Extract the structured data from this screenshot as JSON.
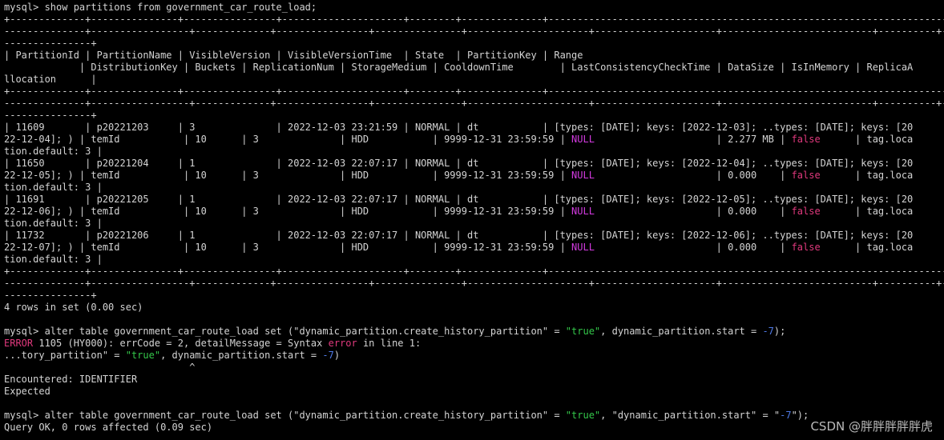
{
  "terminal": {
    "lines": [
      [
        {
          "t": "mysql> show partitions from government_car_route_load;",
          "c": "default"
        }
      ],
      [
        {
          "t": "+-------------+---------------+----------------+---------------------+--------+--------------+--------------------------------------------------------------------------------+----------+--------------",
          "c": "default"
        }
      ],
      [
        {
          "t": "--------------+-----------------+-------------+----------------+---------------+---------------------+---------------------+--------------------------+----------+------------+-------------------------",
          "c": "default"
        }
      ],
      [
        {
          "t": "---------------+",
          "c": "default"
        }
      ],
      [
        {
          "t": "| PartitionId | PartitionName | VisibleVersion | VisibleVersionTime  | State  | PartitionKey | Range",
          "c": "default"
        }
      ],
      [
        {
          "t": "             | DistributionKey | Buckets | ReplicationNum | StorageMedium | CooldownTime        | LastConsistencyCheckTime | DataSize | IsInMemory | ReplicaA",
          "c": "default"
        }
      ],
      [
        {
          "t": "llocation      |",
          "c": "default"
        }
      ],
      [
        {
          "t": "+-------------+---------------+----------------+---------------------+--------+--------------+--------------------------------------------------------------------------------+----------+--------------",
          "c": "default"
        }
      ],
      [
        {
          "t": "--------------+-----------------+-------------+----------------+---------------+---------------------+---------------------+--------------------------+----------+------------+-------------------------",
          "c": "default"
        }
      ],
      [
        {
          "t": "---------------+",
          "c": "default"
        }
      ],
      [
        {
          "t": "| 11609       | p20221203     | 3              | 2022-12-03 23:21:59 | NORMAL | dt           | [types: [DATE]; keys: [2022-12-03]; ..types: [DATE]; keys: [20",
          "c": "default"
        }
      ],
      [
        {
          "t": "22-12-04]; ) | temId           | 10      | 3              | HDD           | 9999-12-31 23:59:59 | ",
          "c": "default"
        },
        {
          "t": "NULL",
          "c": "null"
        },
        {
          "t": "                     | 2.277 MB | ",
          "c": "default"
        },
        {
          "t": "false",
          "c": "false"
        },
        {
          "t": "      | tag.loca",
          "c": "default"
        }
      ],
      [
        {
          "t": "tion.default: 3 |",
          "c": "default"
        }
      ],
      [
        {
          "t": "| 11650       | p20221204     | 1              | 2022-12-03 22:07:17 | NORMAL | dt           | [types: [DATE]; keys: [2022-12-04]; ..types: [DATE]; keys: [20",
          "c": "default"
        }
      ],
      [
        {
          "t": "22-12-05]; ) | temId           | 10      | 3              | HDD           | 9999-12-31 23:59:59 | ",
          "c": "default"
        },
        {
          "t": "NULL",
          "c": "null"
        },
        {
          "t": "                     | 0.000    | ",
          "c": "default"
        },
        {
          "t": "false",
          "c": "false"
        },
        {
          "t": "      | tag.loca",
          "c": "default"
        }
      ],
      [
        {
          "t": "tion.default: 3 |",
          "c": "default"
        }
      ],
      [
        {
          "t": "| 11691       | p20221205     | 1              | 2022-12-03 22:07:17 | NORMAL | dt           | [types: [DATE]; keys: [2022-12-05]; ..types: [DATE]; keys: [20",
          "c": "default"
        }
      ],
      [
        {
          "t": "22-12-06]; ) | temId           | 10      | 3              | HDD           | 9999-12-31 23:59:59 | ",
          "c": "default"
        },
        {
          "t": "NULL",
          "c": "null"
        },
        {
          "t": "                     | 0.000    | ",
          "c": "default"
        },
        {
          "t": "false",
          "c": "false"
        },
        {
          "t": "      | tag.loca",
          "c": "default"
        }
      ],
      [
        {
          "t": "tion.default: 3 |",
          "c": "default"
        }
      ],
      [
        {
          "t": "| 11732       | p20221206     | 1              | 2022-12-03 22:07:17 | NORMAL | dt           | [types: [DATE]; keys: [2022-12-06]; ..types: [DATE]; keys: [20",
          "c": "default"
        }
      ],
      [
        {
          "t": "22-12-07]; ) | temId           | 10      | 3              | HDD           | 9999-12-31 23:59:59 | ",
          "c": "default"
        },
        {
          "t": "NULL",
          "c": "null"
        },
        {
          "t": "                     | 0.000    | ",
          "c": "default"
        },
        {
          "t": "false",
          "c": "false"
        },
        {
          "t": "      | tag.loca",
          "c": "default"
        }
      ],
      [
        {
          "t": "tion.default: 3 |",
          "c": "default"
        }
      ],
      [
        {
          "t": "+-------------+---------------+----------------+---------------------+--------+--------------+--------------------------------------------------------------------------------+----------+--------------",
          "c": "default"
        }
      ],
      [
        {
          "t": "--------------+-----------------+-------------+----------------+---------------+---------------------+---------------------+--------------------------+----------+------------+-------------------------",
          "c": "default"
        }
      ],
      [
        {
          "t": "---------------+",
          "c": "default"
        }
      ],
      [
        {
          "t": "4 rows in set (0.00 sec)",
          "c": "default"
        }
      ],
      [
        {
          "t": "",
          "c": "default"
        }
      ],
      [
        {
          "t": "mysql> alter table government_car_route_load set (\"dynamic_partition.create_history_partition\" = ",
          "c": "default"
        },
        {
          "t": "\"true\"",
          "c": "str"
        },
        {
          "t": ", dynamic_partition.start = ",
          "c": "default"
        },
        {
          "t": "-7",
          "c": "num"
        },
        {
          "t": ");",
          "c": "default"
        }
      ],
      [
        {
          "t": "ERROR",
          "c": "err"
        },
        {
          "t": " 1105 (HY000): errCode = 2, detailMessage = Syntax ",
          "c": "default"
        },
        {
          "t": "error",
          "c": "err"
        },
        {
          "t": " in line 1:",
          "c": "default"
        }
      ],
      [
        {
          "t": "...tory_partition\" = ",
          "c": "default"
        },
        {
          "t": "\"true\"",
          "c": "str"
        },
        {
          "t": ", dynamic_partition.start = ",
          "c": "default"
        },
        {
          "t": "-7",
          "c": "num"
        },
        {
          "t": ")",
          "c": "default"
        }
      ],
      [
        {
          "t": "                                ^",
          "c": "default"
        }
      ],
      [
        {
          "t": "Encountered: IDENTIFIER",
          "c": "default"
        }
      ],
      [
        {
          "t": "Expected",
          "c": "default"
        }
      ],
      [
        {
          "t": "",
          "c": "default"
        }
      ],
      [
        {
          "t": "mysql> alter table government_car_route_load set (\"dynamic_partition.create_history_partition\" = ",
          "c": "default"
        },
        {
          "t": "\"true\"",
          "c": "str"
        },
        {
          "t": ", \"dynamic_partition.start\" = \"",
          "c": "default"
        },
        {
          "t": "-7",
          "c": "num"
        },
        {
          "t": "\");",
          "c": "default"
        }
      ],
      [
        {
          "t": "Query OK, 0 rows affected (0.09 sec)",
          "c": "default"
        }
      ]
    ]
  },
  "watermark": "CSDN @胖胖胖胖胖虎"
}
